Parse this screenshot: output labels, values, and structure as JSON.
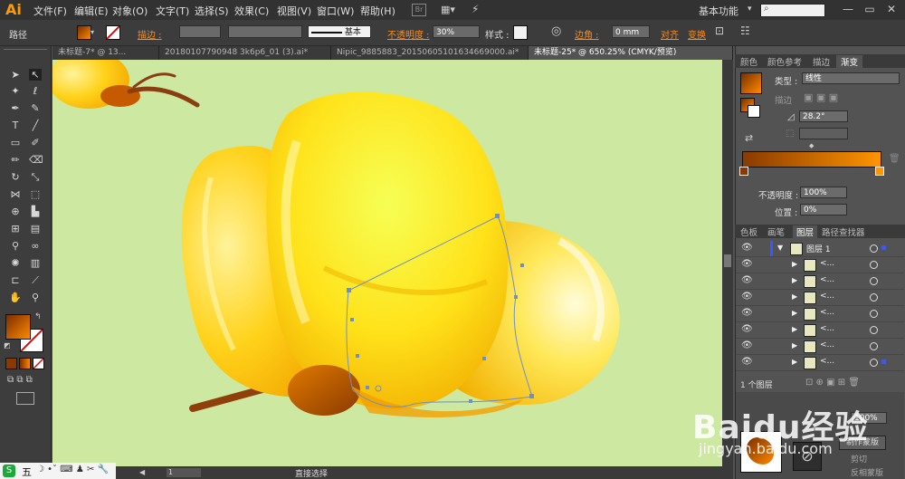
{
  "app": {
    "logo": "Ai",
    "workspace": "基本功能",
    "search_placeholder": ""
  },
  "menu": [
    "文件(F)",
    "编辑(E)",
    "对象(O)",
    "文字(T)",
    "选择(S)",
    "效果(C)",
    "视图(V)",
    "窗口(W)",
    "帮助(H)"
  ],
  "control": {
    "selection_type": "路径",
    "stroke_label": "描边 :",
    "stroke_style": "基本",
    "opacity_label": "不透明度 :",
    "opacity_value": "30%",
    "style_label": "样式 :",
    "corner_label": "边角 :",
    "corner_value": "0 mm",
    "align_label": "对齐",
    "transform_label": "变换"
  },
  "tabs": [
    {
      "label": "未标题-7* @ 13...",
      "active": false
    },
    {
      "label": "20180107790948 3k6p6_01 (3).ai*",
      "active": false
    },
    {
      "label": "Nipic_9885883_20150605101634669000.ai*",
      "active": false
    },
    {
      "label": "未标题-25* @ 650.25% (CMYK/预览)",
      "active": true
    }
  ],
  "gradient_panel": {
    "tabs": [
      "颜色",
      "颜色参考",
      "描边",
      "渐变"
    ],
    "type_label": "类型 :",
    "type_value": "线性",
    "stroke_label": "描边",
    "angle_value": "28.2°",
    "opacity_label": "不透明度 :",
    "opacity_value": "100%",
    "location_label": "位置 :",
    "location_value": "0%",
    "colors": {
      "start": "#8a3a00",
      "end": "#ff9500"
    }
  },
  "layers_panel": {
    "tabs": [
      "色板",
      "画笔",
      "图层",
      "路径查找器"
    ],
    "layer_name": "图层 1",
    "sublayers": [
      "<...",
      "<...",
      "<...",
      "<...",
      "<...",
      "<...",
      "<...",
      "<..."
    ],
    "footer_count": "1 个图层"
  },
  "bottom_panel": {
    "make_mask": "制作蒙版",
    "clip": "剪切",
    "invert_mask": "反相蒙版",
    "opacity": "100%"
  },
  "status": {
    "zoom": "650.25%",
    "page": "1",
    "tool": "直接选择"
  },
  "ime": {
    "label": "五"
  },
  "watermark": {
    "brand": "Baidu经验",
    "url": "jingyan.baidu.com"
  }
}
